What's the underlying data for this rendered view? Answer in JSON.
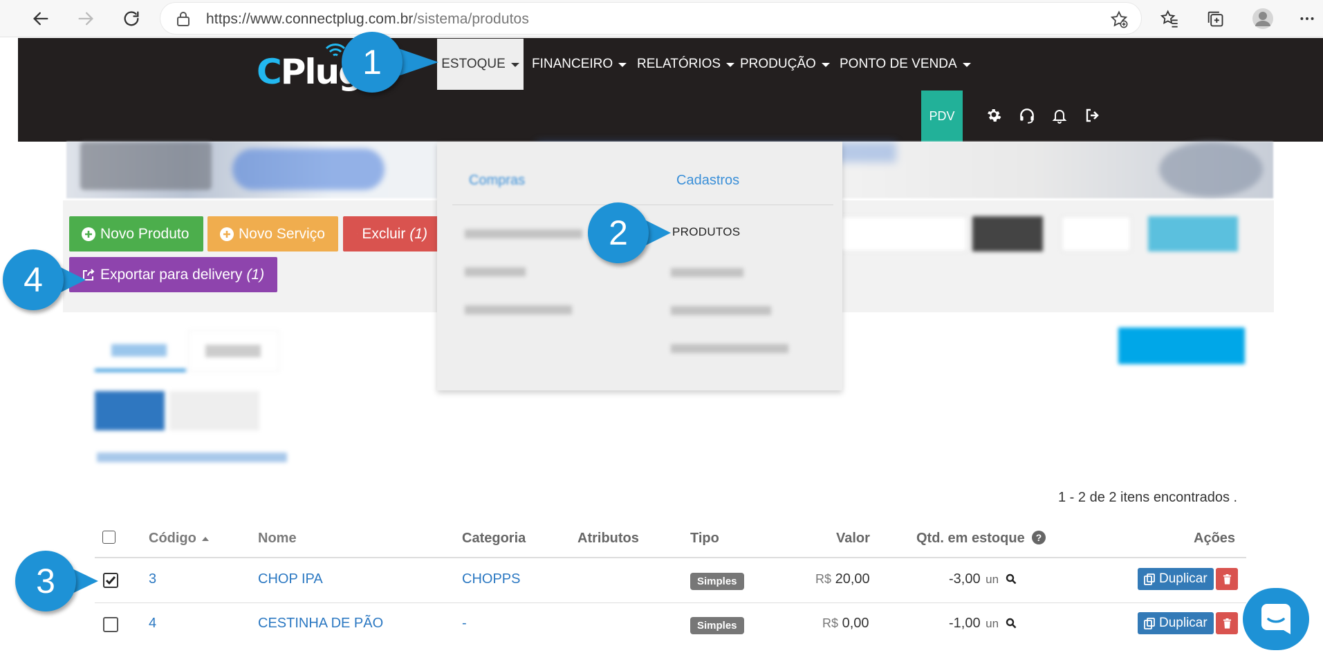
{
  "browser": {
    "url_prefix": "https://www.connectplug.com.br",
    "url_path": "/sistema/produtos"
  },
  "header": {
    "logo_c": "C",
    "logo_text": "Plug",
    "menu": [
      {
        "label": "ESTOQUE"
      },
      {
        "label": "FINANCEIRO"
      },
      {
        "label": "RELATÓRIOS"
      },
      {
        "label": "PRODUÇÃO"
      },
      {
        "label": "PONTO DE VENDA"
      }
    ],
    "pdv_label": "PDV"
  },
  "dropdown": {
    "compras_header": "Compras",
    "cadastros_header": "Cadastros",
    "produtos_label": "PRODUTOS"
  },
  "toolbar": {
    "novo_produto": "Novo Produto",
    "novo_servico": "Novo Serviço",
    "excluir": "Excluir",
    "excluir_count": "(1)",
    "exportar": "Exportar para delivery",
    "exportar_count": "(1)"
  },
  "callouts": {
    "one": "1",
    "two": "2",
    "three": "3",
    "four": "4"
  },
  "table": {
    "items_found": "1 - 2 de 2 itens encontrados .",
    "headers": {
      "codigo": "Código",
      "nome": "Nome",
      "categoria": "Categoria",
      "atributos": "Atributos",
      "tipo": "Tipo",
      "valor": "Valor",
      "qtd_estoque": "Qtd. em estoque",
      "acoes": "Ações"
    },
    "rows": [
      {
        "codigo": "3",
        "nome": "CHOP IPA",
        "categoria": "CHOPPS",
        "tipo": "Simples",
        "currency": "R$",
        "valor": "20,00",
        "qtd": "-3,00",
        "unit": "un",
        "duplicar": "Duplicar",
        "checked": true
      },
      {
        "codigo": "4",
        "nome": "CESTINHA DE PÃO",
        "categoria": "-",
        "tipo": "Simples",
        "currency": "R$",
        "valor": "0,00",
        "qtd": "-1,00",
        "unit": "un",
        "duplicar": "Duplicar",
        "checked": false
      }
    ]
  },
  "colors": {
    "header_bg": "#231f1f",
    "accent_blue": "#1e92d6",
    "success": "#4cae4c",
    "warning": "#f0ad4e",
    "danger": "#d9534f",
    "purple": "#8e44ad",
    "pdv": "#22b199"
  },
  "icons": [
    "back-arrow-icon",
    "forward-arrow-icon",
    "refresh-icon",
    "lock-icon",
    "star-add-icon",
    "favorites-icon",
    "collections-icon",
    "profile-icon",
    "more-icon",
    "gear-icon",
    "headset-icon",
    "bell-icon",
    "logout-icon",
    "plus-circle-icon",
    "trash-icon",
    "share-icon",
    "question-icon",
    "search-icon",
    "copy-icon",
    "chat-icon",
    "sort-up-icon",
    "check-icon"
  ]
}
